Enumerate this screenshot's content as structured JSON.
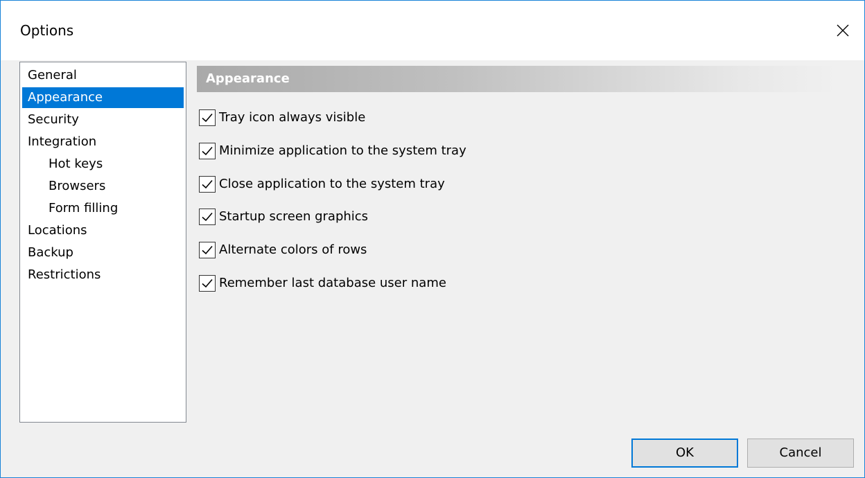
{
  "window": {
    "title": "Options"
  },
  "nav": {
    "items": [
      {
        "label": "General",
        "level": 0,
        "selected": false
      },
      {
        "label": "Appearance",
        "level": 0,
        "selected": true
      },
      {
        "label": "Security",
        "level": 0,
        "selected": false
      },
      {
        "label": "Integration",
        "level": 0,
        "selected": false
      },
      {
        "label": "Hot keys",
        "level": 1,
        "selected": false
      },
      {
        "label": "Browsers",
        "level": 1,
        "selected": false
      },
      {
        "label": "Form filling",
        "level": 1,
        "selected": false
      },
      {
        "label": "Locations",
        "level": 0,
        "selected": false
      },
      {
        "label": "Backup",
        "level": 0,
        "selected": false
      },
      {
        "label": "Restrictions",
        "level": 0,
        "selected": false
      }
    ]
  },
  "section": {
    "title": "Appearance"
  },
  "options": [
    {
      "label": "Tray icon always visible",
      "checked": true
    },
    {
      "label": "Minimize application to the system tray",
      "checked": true
    },
    {
      "label": "Close application to the system tray",
      "checked": true
    },
    {
      "label": "Startup screen graphics",
      "checked": true
    },
    {
      "label": "Alternate colors of rows",
      "checked": true
    },
    {
      "label": "Remember last database user name",
      "checked": true
    }
  ],
  "buttons": {
    "ok": "OK",
    "cancel": "Cancel"
  },
  "colors": {
    "accent": "#0078d7",
    "window_border": "#1883d7",
    "selection": "#0078d7"
  }
}
